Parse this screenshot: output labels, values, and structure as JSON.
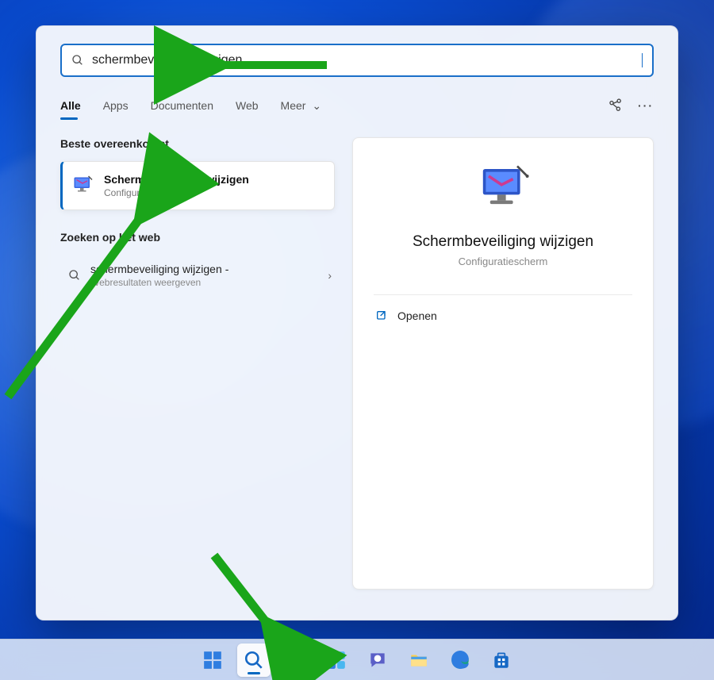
{
  "search": {
    "value": "schermbeveiliging wijzigen",
    "placeholder": ""
  },
  "tabs": {
    "all": "Alle",
    "apps": "Apps",
    "documents": "Documenten",
    "web": "Web",
    "more": "Meer"
  },
  "sections": {
    "best_match": "Beste overeenkomst",
    "search_web": "Zoeken op het web"
  },
  "best_match_result": {
    "title": "Schermbeveiliging wijzigen",
    "category": "Configuratiescherm"
  },
  "web_result": {
    "query": "schermbeveiliging wijzigen",
    "dash": "-",
    "subtitle": "Webresultaten weergeven"
  },
  "preview": {
    "title": "Schermbeveiliging wijzigen",
    "category": "Configuratiescherm",
    "open": "Openen"
  }
}
